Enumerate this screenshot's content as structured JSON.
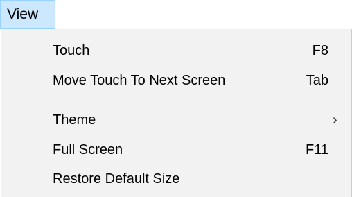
{
  "menubar": {
    "view_label": "View"
  },
  "menu": {
    "items": [
      {
        "label": "Touch",
        "shortcut": "F8"
      },
      {
        "label": "Move Touch To Next Screen",
        "shortcut": "Tab"
      },
      {
        "label": "Theme",
        "shortcut": "",
        "submenu_icon": "chevron-right-icon",
        "submenu_glyph": "›"
      },
      {
        "label": "Full Screen",
        "shortcut": "F11"
      },
      {
        "label": "Restore Default Size",
        "shortcut": ""
      }
    ]
  },
  "colors": {
    "menubar_active_bg": "#cce8ff",
    "menubar_active_border": "#99d1ff",
    "menu_bg": "#f2f2f2",
    "separator": "#d7d7d7"
  }
}
